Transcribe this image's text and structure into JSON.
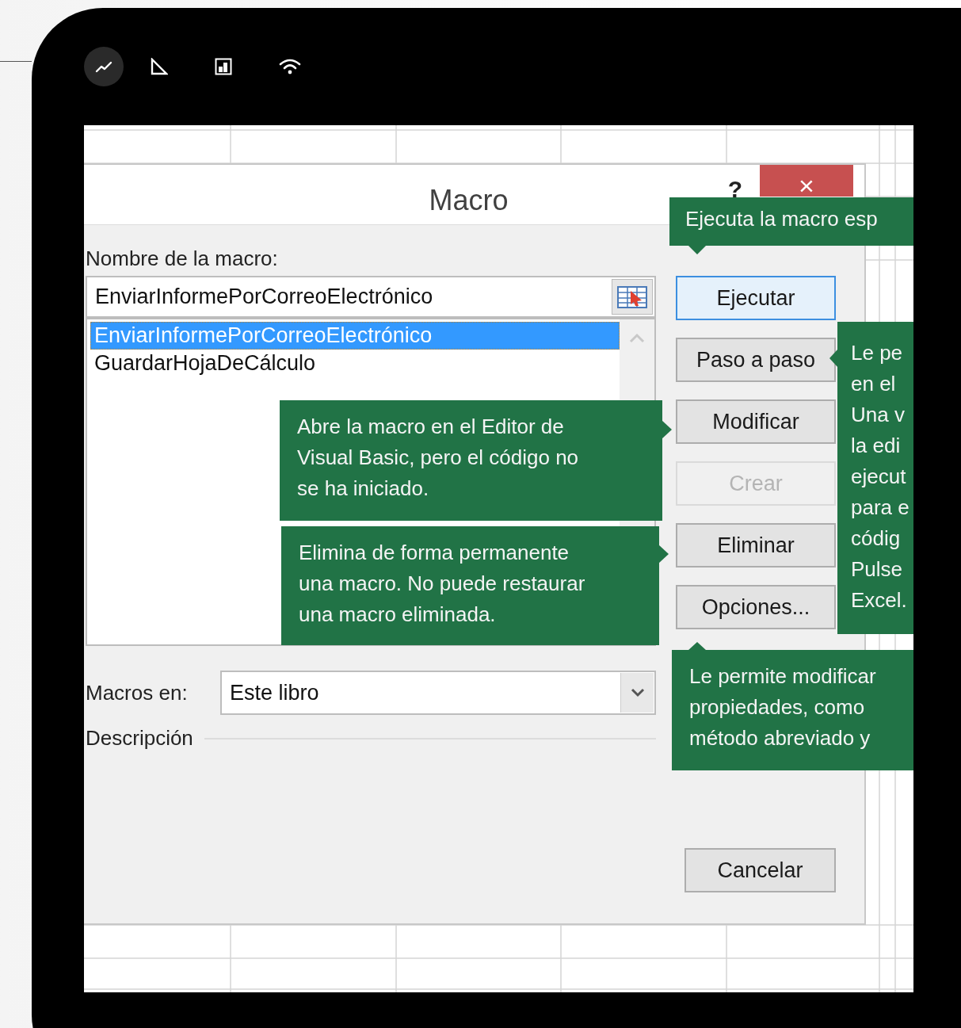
{
  "status_icons": [
    {
      "selected": true
    },
    {
      "selected": false
    },
    {
      "selected": false
    },
    {
      "selected": false
    }
  ],
  "dialog": {
    "title": "Macro",
    "help": "?",
    "close": "×",
    "name_label": "Nombre de la macro:",
    "name_value": "EnviarInformePorCorreoElectrónico",
    "macros": [
      {
        "label": "EnviarInformePorCorreoElectrónico",
        "selected": true
      },
      {
        "label": "GuardarHojaDeCálculo",
        "selected": false
      }
    ],
    "macros_in_label": "Macros en:",
    "macros_in_value": "Este libro",
    "description_label": "Descripción",
    "buttons": [
      {
        "label": "Ejecutar",
        "default": true,
        "disabled": false
      },
      {
        "label": "Paso a paso",
        "default": false,
        "disabled": false
      },
      {
        "label": "Modificar",
        "default": false,
        "disabled": false
      },
      {
        "label": "Crear",
        "default": false,
        "disabled": true
      },
      {
        "label": "Eliminar",
        "default": false,
        "disabled": false
      },
      {
        "label": "Opciones...",
        "default": false,
        "disabled": false
      }
    ],
    "cancel": "Cancelar"
  },
  "tooltips": [
    {
      "kind": "down",
      "lines": [
        "Ejecuta la macro esp"
      ]
    },
    {
      "kind": "left",
      "lines": [
        "Le pe",
        "en el",
        "Una v",
        "la edi",
        "ejecut",
        "para e",
        "códig",
        "Pulse",
        "Excel."
      ]
    },
    {
      "kind": "right",
      "lines": [
        "Abre la macro en el Editor de",
        "Visual Basic, pero el código no",
        "se ha iniciado."
      ]
    },
    {
      "kind": "right",
      "lines": [
        "Elimina de forma permanente",
        "una macro. No puede restaurar",
        "una macro eliminada."
      ]
    },
    {
      "kind": "up",
      "lines": [
        "Le permite modificar",
        "propiedades, como",
        "método abreviado y"
      ]
    }
  ]
}
